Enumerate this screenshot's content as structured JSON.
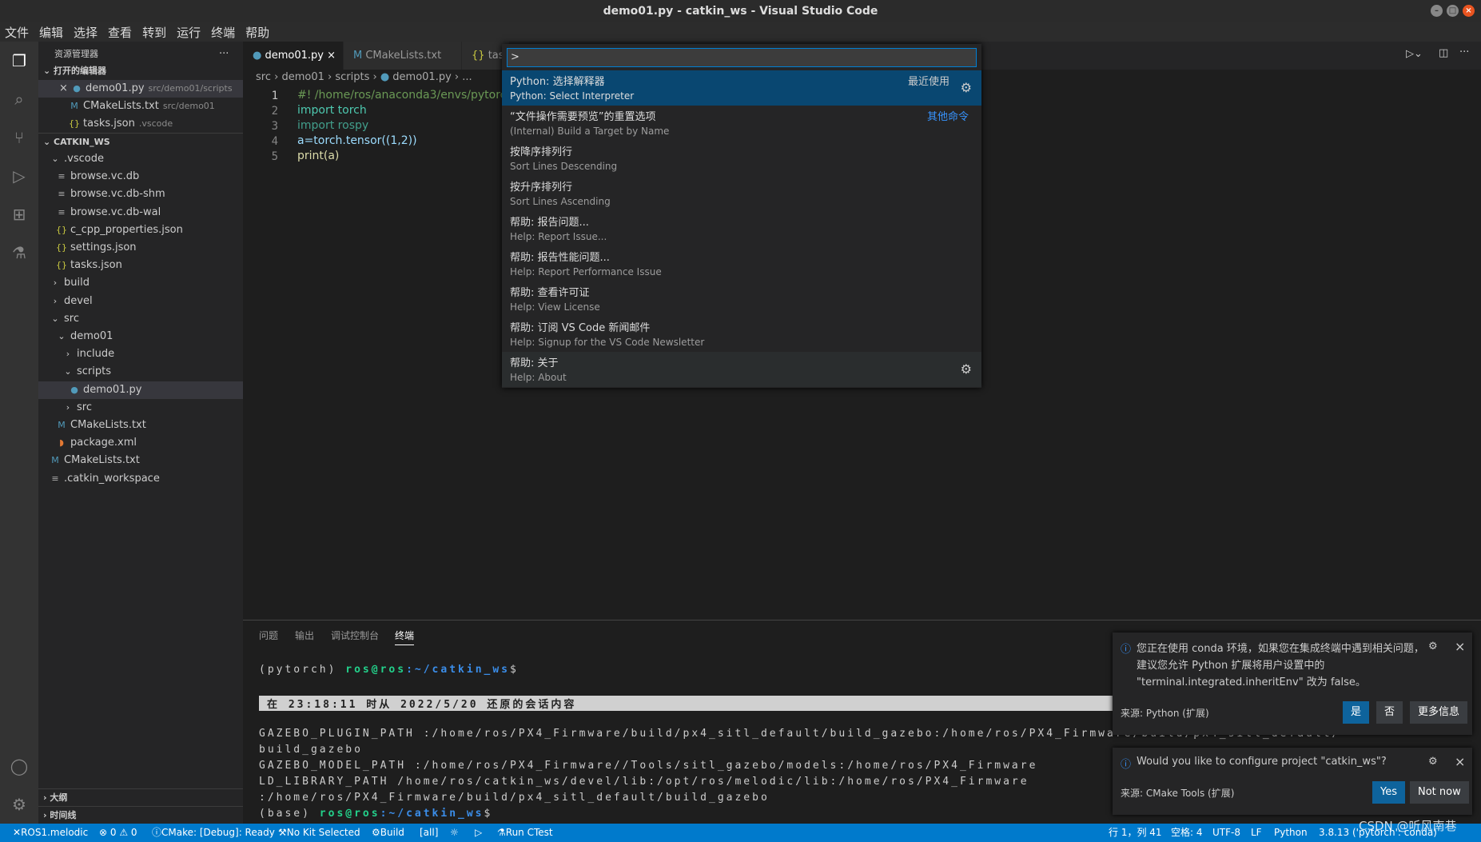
{
  "window": {
    "title": "demo01.py - catkin_ws - Visual Studio Code"
  },
  "menu": [
    "文件",
    "编辑",
    "选择",
    "查看",
    "转到",
    "运行",
    "终端",
    "帮助"
  ],
  "sidebar": {
    "title": "资源管理器",
    "open_editors": "打开的编辑器",
    "workspace": "CATKIN_WS",
    "open": [
      {
        "name": "demo01.py",
        "hint": "src/demo01/scripts"
      },
      {
        "name": "CMakeLists.txt",
        "hint": "src/demo01"
      },
      {
        "name": "tasks.json",
        "hint": ".vscode"
      }
    ],
    "tree": [
      ".vscode",
      "browse.vc.db",
      "browse.vc.db-shm",
      "browse.vc.db-wal",
      "c_cpp_properties.json",
      "settings.json",
      "tasks.json",
      "build",
      "devel",
      "src",
      "demo01",
      "include",
      "scripts",
      "demo01.py",
      "src",
      "CMakeLists.txt",
      "package.xml",
      "CMakeLists.txt",
      ".catkin_workspace"
    ],
    "outline": "大纲",
    "timeline": "时间线"
  },
  "tabs": [
    "demo01.py",
    "CMakeLists.txt",
    "tas"
  ],
  "breadcrumb": [
    "src",
    "demo01",
    "scripts",
    "demo01.py",
    "..."
  ],
  "code": [
    "#! /home/ros/anaconda3/envs/pytorch/",
    "import torch",
    "import rospy",
    "a=torch.tensor((1,2))",
    "print(a)"
  ],
  "palette": {
    "input": ">",
    "items": [
      {
        "zh": "Python: 选择解释器",
        "en": "Python: Select Interpreter",
        "right": "最近使用"
      },
      {
        "zh": "“文件操作需要预览”的重置选项",
        "en": "(Internal) Build a Target by Name",
        "right": "其他命令"
      },
      {
        "zh": "按降序排列行",
        "en": "Sort Lines Descending"
      },
      {
        "zh": "按升序排列行",
        "en": "Sort Lines Ascending"
      },
      {
        "zh": "帮助: 报告问题...",
        "en": "Help: Report Issue..."
      },
      {
        "zh": "帮助: 报告性能问题...",
        "en": "Help: Report Performance Issue"
      },
      {
        "zh": "帮助: 查看许可证",
        "en": "Help: View License"
      },
      {
        "zh": "帮助: 订阅 VS Code 新闻邮件",
        "en": "Help: Signup for the VS Code Newsletter"
      },
      {
        "zh": "帮助: 关于",
        "en": "Help: About"
      }
    ]
  },
  "panel": {
    "tabs": [
      "问题",
      "输出",
      "调试控制台",
      "终端"
    ],
    "term": {
      "p1": "(pytorch) ",
      "user": "ros@ros",
      "path": ":~/catkin_ws",
      "dollar": "$",
      "restore": "在 23:18:11 时从 2022/5/20 还原的会话内容",
      "lines": [
        "GAZEBO_PLUGIN_PATH :/home/ros/PX4_Firmware/build/px4_sitl_default/build_gazebo:/home/ros/PX4_Firmware/build/px4_sitl_default/",
        "build_gazebo",
        "GAZEBO_MODEL_PATH :/home/ros/PX4_Firmware//Tools/sitl_gazebo/models:/home/ros/PX4_Firmware",
        "LD_LIBRARY_PATH /home/ros/catkin_ws/devel/lib:/opt/ros/melodic/lib:/home/ros/PX4_Firmware",
        ":/home/ros/PX4_Firmware/build/px4_sitl_default/build_gazebo"
      ],
      "p2": "(base) "
    }
  },
  "notifications": [
    {
      "lines": [
        "您正在使用 conda 环境，如果您在集成终端中遇到相关问题，",
        "建议您允许 Python 扩展将用户设置中的",
        "\"terminal.integrated.inheritEnv\" 改为 false。"
      ],
      "source": "来源: Python (扩展)",
      "buttons": [
        "是",
        "否",
        "更多信息"
      ]
    },
    {
      "lines": [
        "Would you like to configure project \"catkin_ws\"?"
      ],
      "source": "来源: CMake Tools (扩展)",
      "buttons": [
        "Yes",
        "Not now"
      ]
    }
  ],
  "status": {
    "ros": "ROS1.melodic",
    "problems": "⊗ 0 ⚠ 0",
    "cmake": "CMake: [Debug]: Ready",
    "kit": "No Kit Selected",
    "build": "Build",
    "all": "[all]",
    "ctest": "Run CTest",
    "pos": "行 1，列 41",
    "spaces": "空格: 4",
    "enc": "UTF-8",
    "eol": "LF",
    "lang": "Python",
    "interp": "3.8.13 ('pytorch': conda)"
  },
  "watermark": "CSDN @听风南巷"
}
